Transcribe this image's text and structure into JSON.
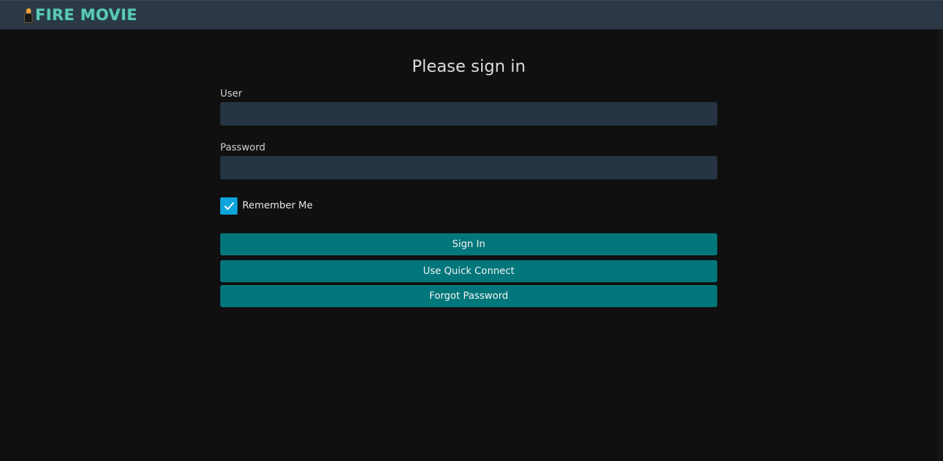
{
  "header": {
    "brand": "FIRE MOVIE",
    "brand_icon": "fire-lantern-icon"
  },
  "login": {
    "title": "Please sign in",
    "user_label": "User",
    "user_value": "",
    "password_label": "Password",
    "password_value": "",
    "remember_label": "Remember Me",
    "remember_checked": true,
    "signin_label": "Sign In",
    "quick_connect_label": "Use Quick Connect",
    "forgot_label": "Forgot Password"
  },
  "colors": {
    "background": "#101010",
    "header": "#2c3846",
    "input": "#263444",
    "button": "#02777b",
    "checkbox": "#0da4dc",
    "brand": "#5ec8b6"
  }
}
